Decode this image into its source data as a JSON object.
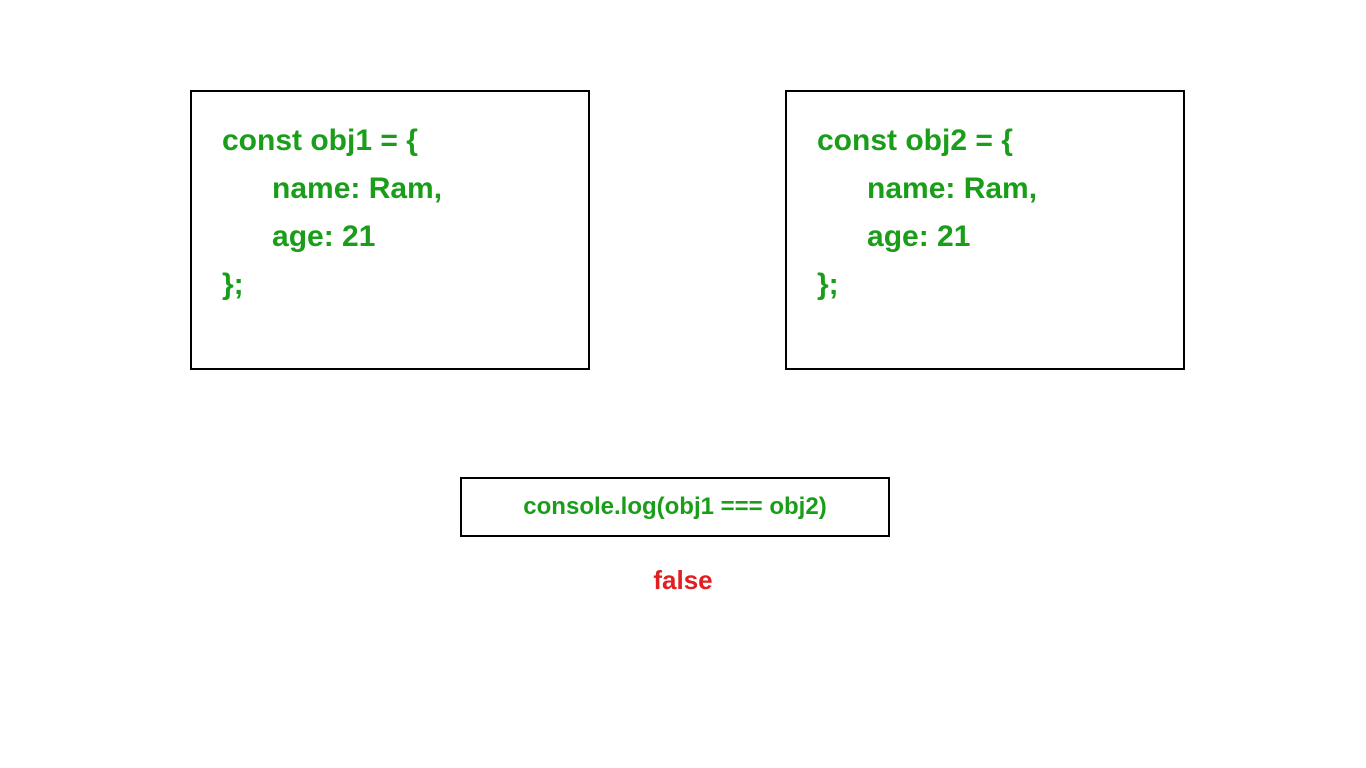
{
  "leftBox": {
    "line1": "const obj1 = {",
    "line2": "      name: Ram,",
    "line3": "      age: 21",
    "line4": "};"
  },
  "rightBox": {
    "line1": "const obj2 = {",
    "line2": "      name: Ram,",
    "line3": "      age: 21",
    "line4": "};"
  },
  "consoleBox": {
    "text": "console.log(obj1 === obj2)"
  },
  "result": "false"
}
